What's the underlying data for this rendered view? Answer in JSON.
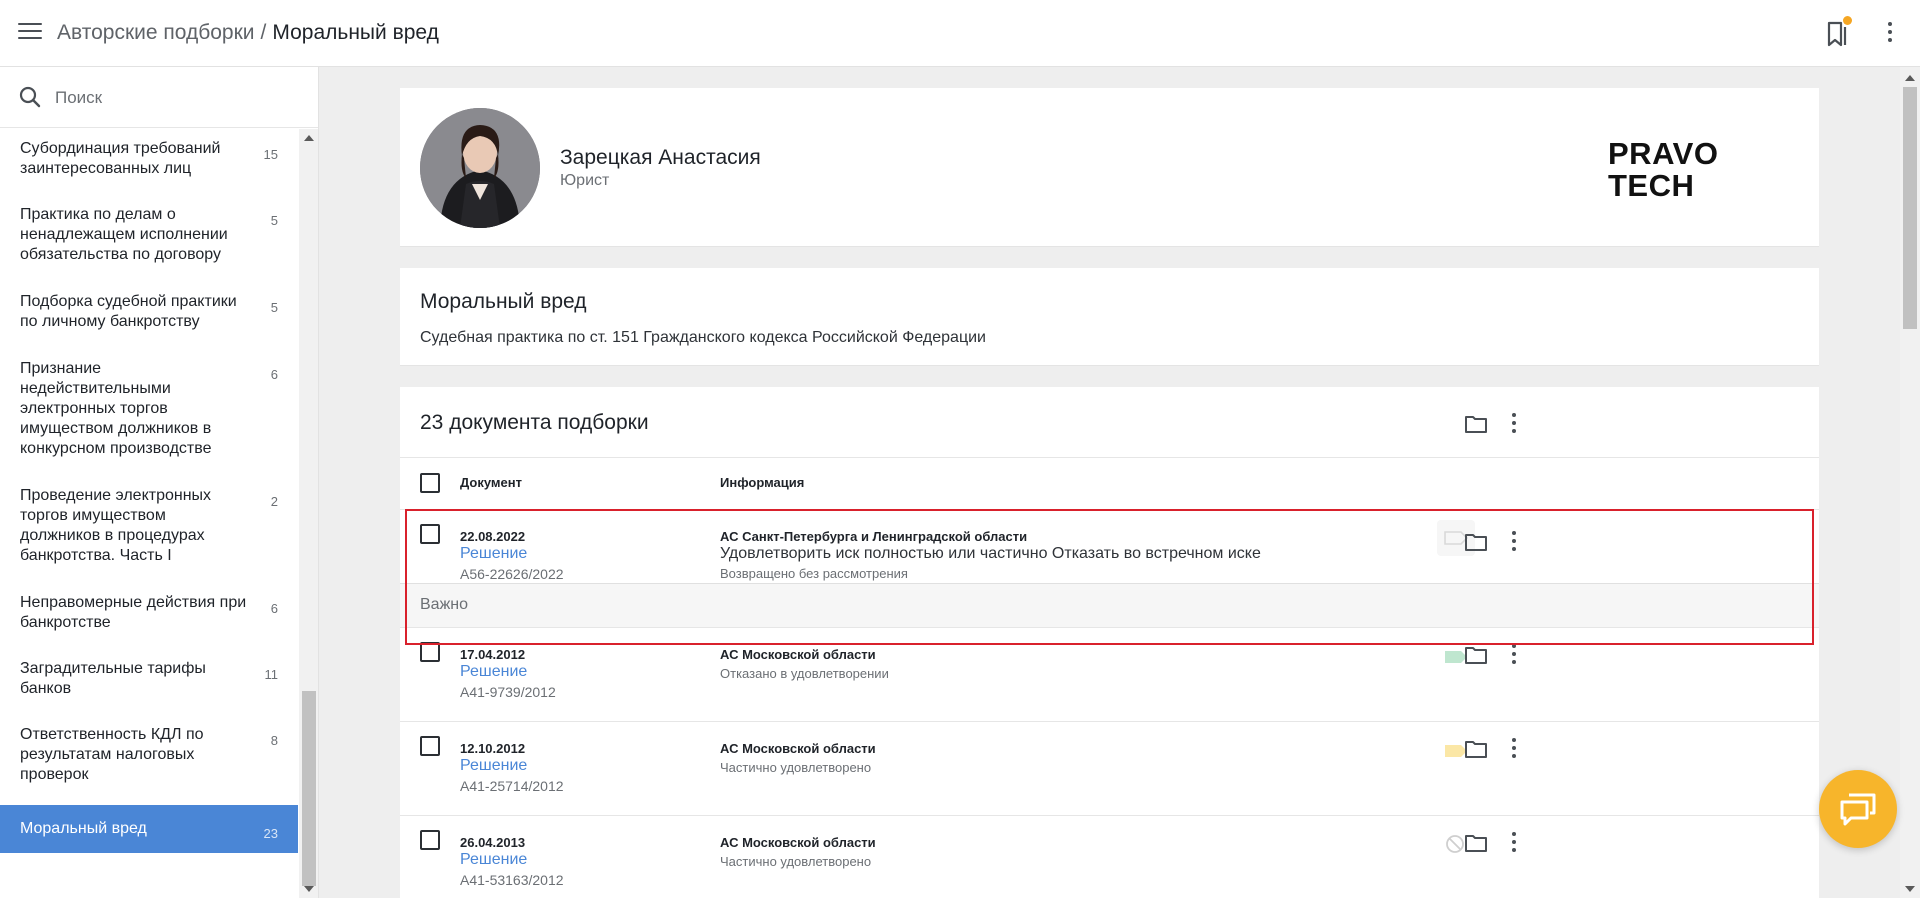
{
  "header": {
    "breadcrumb_parent": "Авторские подборки",
    "breadcrumb_separator": "/",
    "breadcrumb_current": "Моральный вред",
    "notification_color": "#f5a623"
  },
  "sidebar": {
    "search_placeholder": "Поиск",
    "items": [
      {
        "label": "Субординация требований заинтересованных лиц",
        "count": "15"
      },
      {
        "label": "Практика по делам о ненадлежащем исполнении обязательства по договору",
        "count": "5"
      },
      {
        "label": "Подборка судебной практики по личному банкротству",
        "count": "5"
      },
      {
        "label": "Признание недействительными электронных торгов имуществом должников в конкурсном производстве",
        "count": "6"
      },
      {
        "label": "Проведение электронных торгов имуществом должников в процедурах банкротства. Часть I",
        "count": "2"
      },
      {
        "label": "Неправомерные действия при банкротстве",
        "count": "6"
      },
      {
        "label": "Заградительные тарифы банков",
        "count": "11"
      },
      {
        "label": "Ответственность КДЛ по результатам налоговых проверок",
        "count": "8"
      },
      {
        "label": "Моральный вред",
        "count": "23"
      }
    ],
    "active_color": "#4a86d6"
  },
  "profile": {
    "name": "Зарецкая Анастасия",
    "role": "Юрист",
    "logo_line1": "PRAVO",
    "logo_line2": "TECH"
  },
  "topic": {
    "title": "Моральный вред",
    "subtitle": "Судебная практика по ст. 151 Гражданского кодекса Российской Федерации"
  },
  "documents": {
    "title": "23 документа подборки",
    "col_document": "Документ",
    "col_info": "Информация",
    "rows": [
      {
        "date": "22.08.2022",
        "type": "Решение",
        "number": "А56-22626/2022",
        "court": "АС Санкт-Петербурга и Ленинградской области",
        "summary": "Удовлетворить иск полностью или частично Отказать во встречном иске",
        "status": "Возвращено без рассмотрения",
        "note": "Важно",
        "tag": "outline-tag-icon",
        "tag_color": "#d9d9d9"
      },
      {
        "date": "17.04.2012",
        "type": "Решение",
        "number": "А41-9739/2012",
        "court": "АС Московской области",
        "status": "Отказано в удовлетворении",
        "tag": "tag-icon",
        "tag_color": "#bfe6cf"
      },
      {
        "date": "12.10.2012",
        "type": "Решение",
        "number": "А41-25714/2012",
        "court": "АС Московской области",
        "status": "Частично удовлетворено",
        "tag": "tag-icon",
        "tag_color": "#fbe7a6"
      },
      {
        "date": "26.04.2013",
        "type": "Решение",
        "number": "А41-53163/2012",
        "court": "АС Московской области",
        "status": "Частично удовлетворено",
        "tag": "no-tag-icon",
        "tag_color": "#cfcfcf"
      }
    ],
    "highlight_color": "#d9212c"
  },
  "chat": {
    "color": "#f7b52b"
  }
}
